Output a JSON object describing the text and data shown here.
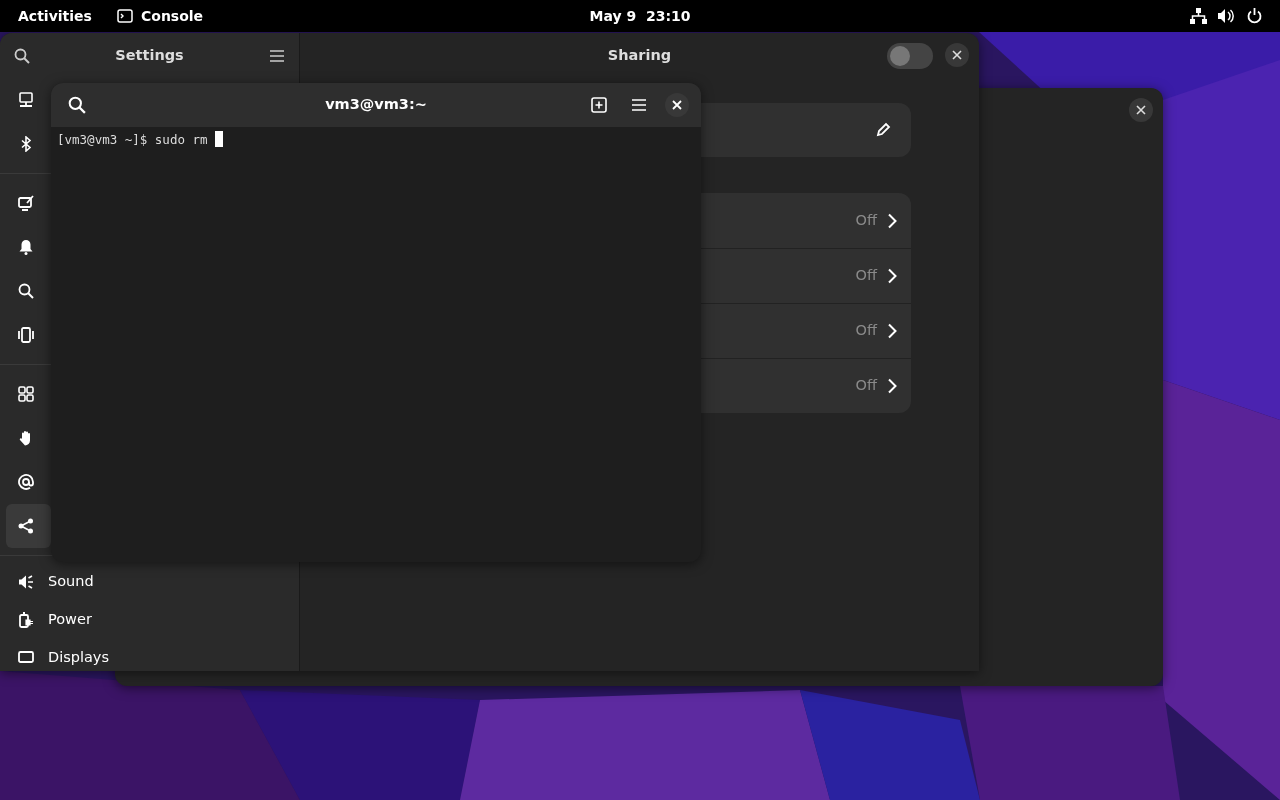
{
  "top_bar": {
    "activities": "Activities",
    "app": "Console",
    "clock": "May 9  23:10"
  },
  "settings": {
    "sidebar_title": "Settings",
    "sidebar_sections": [
      [
        {
          "selected": false
        },
        {
          "selected": false
        }
      ],
      [
        {
          "selected": false
        },
        {
          "selected": false
        },
        {
          "selected": false
        },
        {
          "selected": false
        }
      ],
      [
        {
          "selected": false
        },
        {
          "selected": false
        },
        {
          "selected": false
        },
        {
          "selected": true
        }
      ],
      [
        {
          "label": "Sound",
          "selected": false
        },
        {
          "label": "Power",
          "selected": false
        },
        {
          "label": "Displays",
          "selected": false
        }
      ]
    ],
    "panel_title": "Sharing",
    "sharing_on": false,
    "rows": [
      {
        "value": "Off"
      },
      {
        "value": "Off"
      },
      {
        "value": "Off"
      },
      {
        "value": "Off"
      }
    ]
  },
  "terminal": {
    "title": "vm3@vm3:~",
    "lines": [
      "[vm3@vm3 ~]$ sudo rm "
    ]
  }
}
